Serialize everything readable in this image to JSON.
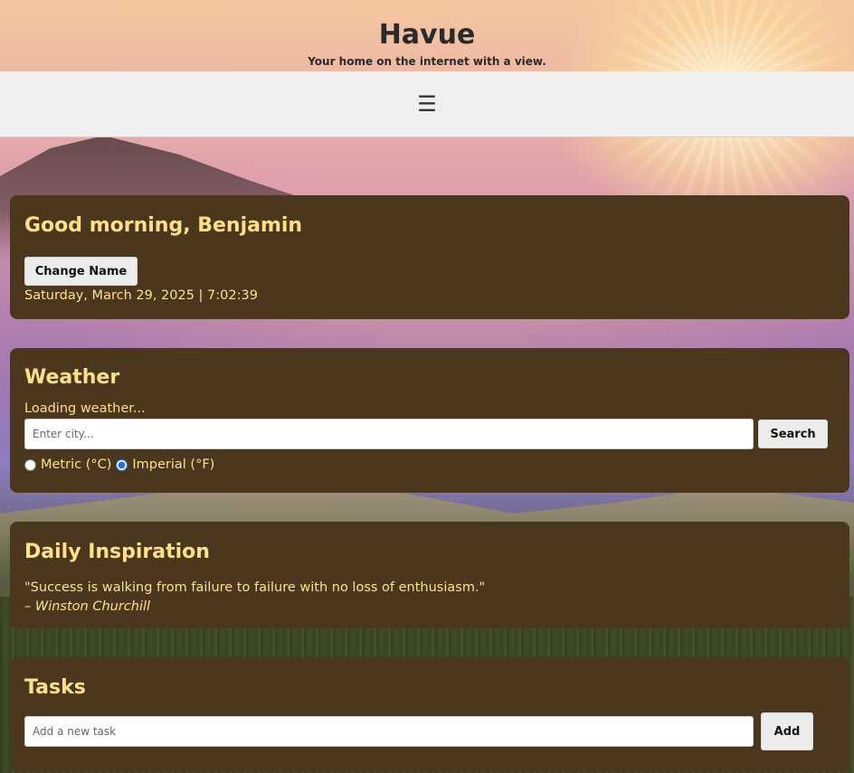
{
  "header": {
    "title": "Havue",
    "tagline": "Your home on the internet with a view."
  },
  "nav": {
    "menu_icon": "hamburger-menu-icon",
    "menu_glyph": "☰"
  },
  "greeting": {
    "heading": "Good morning, Benjamin",
    "change_name_label": "Change Name",
    "datetime": "Saturday, March 29, 2025 | 7:02:39"
  },
  "weather": {
    "heading": "Weather",
    "status": "Loading weather...",
    "city_placeholder": "Enter city...",
    "city_value": "",
    "search_label": "Search",
    "units": [
      {
        "label": "Metric (°C)",
        "checked": false
      },
      {
        "label": "Imperial (°F)",
        "checked": true
      }
    ]
  },
  "inspiration": {
    "heading": "Daily Inspiration",
    "quote": "\"Success is walking from failure to failure with no loss of enthusiasm.\"",
    "author": "– Winston Churchill"
  },
  "tasks": {
    "heading": "Tasks",
    "task_placeholder": "Add a new task",
    "task_value": "",
    "add_label": "Add"
  },
  "colors": {
    "card_background": "#4a371e",
    "card_text": "#ffe08a",
    "navbar_background": "#efefef"
  }
}
